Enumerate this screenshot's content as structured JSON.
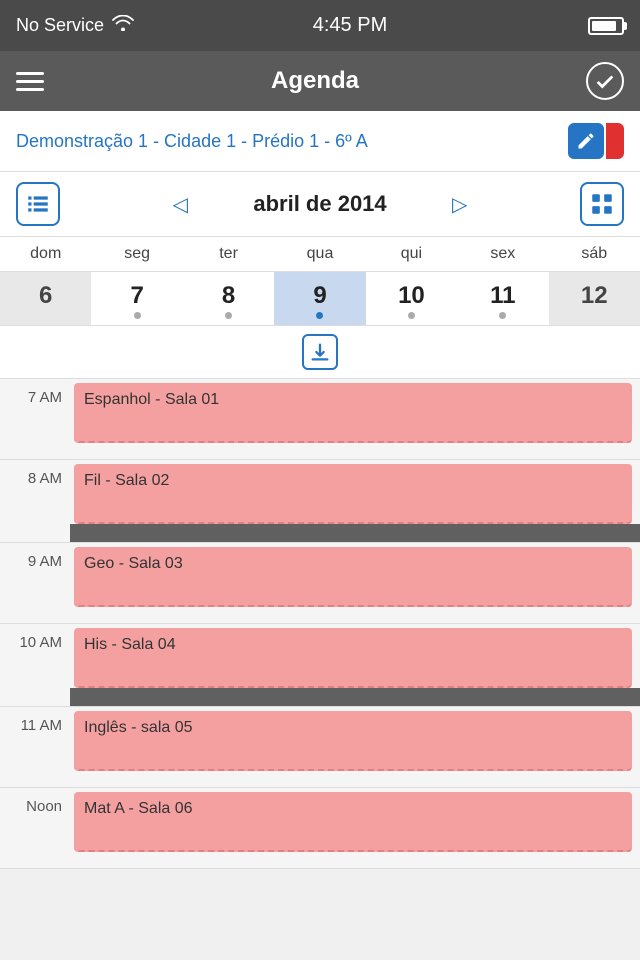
{
  "statusBar": {
    "signal": "No Service",
    "wifi": "wifi",
    "time": "4:45 PM",
    "battery": 85
  },
  "navBar": {
    "title": "Agenda",
    "menuIcon": "menu-icon",
    "checkIcon": "check-icon"
  },
  "subtitle": {
    "text": "Demonstração 1 - Cidade 1 - Prédio 1 - 6º A",
    "editIcon": "edit-icon"
  },
  "calendar": {
    "listIcon": "list-icon",
    "gridIcon": "grid-icon",
    "prevArrow": "◁",
    "nextArrow": "▷",
    "monthLabel": "abril de 2014",
    "days": {
      "headers": [
        "dom",
        "seg",
        "ter",
        "qua",
        "qui",
        "sex",
        "sáb"
      ],
      "numbers": [
        {
          "num": "6",
          "style": "grayed",
          "dot": false
        },
        {
          "num": "7",
          "style": "normal",
          "dot": true
        },
        {
          "num": "8",
          "style": "normal",
          "dot": true
        },
        {
          "num": "9",
          "style": "today",
          "dot": true
        },
        {
          "num": "10",
          "style": "normal",
          "dot": true
        },
        {
          "num": "11",
          "style": "normal",
          "dot": true
        },
        {
          "num": "12",
          "style": "grayed",
          "dot": false
        }
      ]
    }
  },
  "schedule": {
    "slots": [
      {
        "time": "7 AM",
        "event": "Espanhol - Sala 01",
        "type": "pink"
      },
      {
        "time": "8 AM",
        "event": "Fil - Sala 02",
        "type": "pink",
        "hasDarkBar": true
      },
      {
        "time": "9 AM",
        "event": "Geo - Sala 03",
        "type": "pink",
        "hasDarkBar": true
      },
      {
        "time": "10 AM",
        "event": "His - Sala 04",
        "type": "pink"
      },
      {
        "time": "11 AM",
        "event": "Inglês - sala 05",
        "type": "pink",
        "hasDarkBar": true
      },
      {
        "time": "Noon",
        "event": "Mat A - Sala 06",
        "type": "pink"
      }
    ]
  }
}
